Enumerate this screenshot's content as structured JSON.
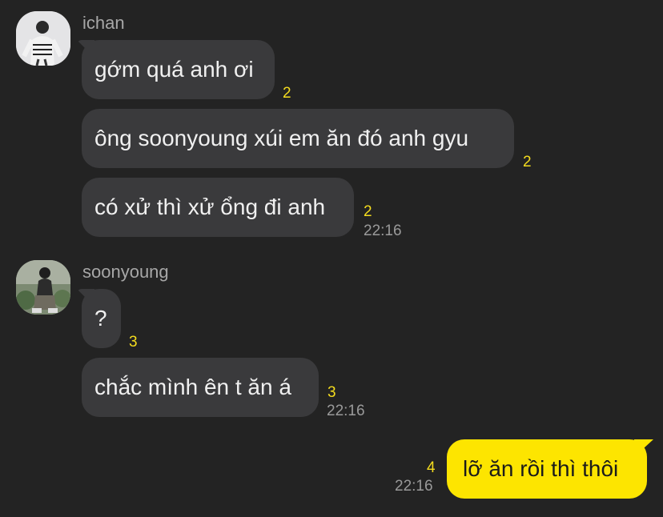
{
  "messages": {
    "group1": {
      "sender": "ichan",
      "avatar_icon": "profile-photo-ichan",
      "bubbles": [
        {
          "text": "gớm quá anh ơi",
          "unread": "2"
        },
        {
          "text": "ông soonyoung xúi em ăn đó anh gyu",
          "unread": "2"
        },
        {
          "text": "có xử thì xử ổng đi anh",
          "unread": "2",
          "time": "22:16"
        }
      ]
    },
    "group2": {
      "sender": "soonyoung",
      "avatar_icon": "profile-photo-soonyoung",
      "bubbles": [
        {
          "text": "?",
          "unread": "3"
        },
        {
          "text": "chắc mình ên t ăn á",
          "unread": "3",
          "time": "22:16"
        }
      ]
    },
    "mine": {
      "text": "lỡ ăn rồi thì thôi",
      "unread": "4",
      "time": "22:16"
    }
  },
  "colors": {
    "background": "#232323",
    "incoming_bubble": "#3a3a3c",
    "outgoing_bubble": "#fde500",
    "unread_count": "#f4dc1e",
    "timestamp": "#9a9a9a"
  }
}
